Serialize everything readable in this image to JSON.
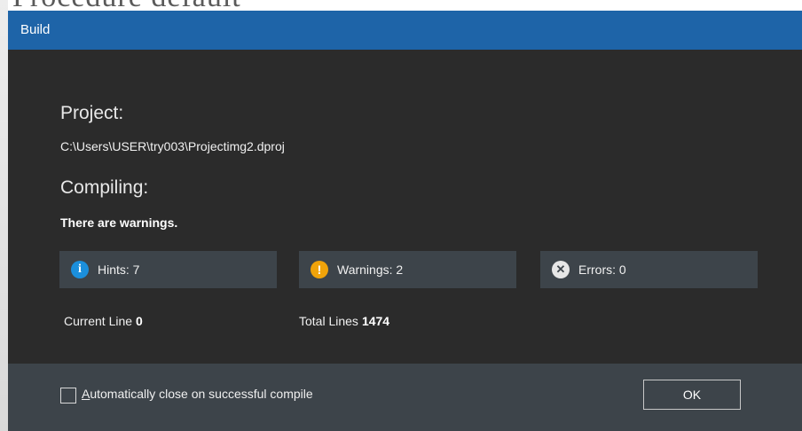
{
  "window": {
    "title": "Build"
  },
  "backdrop": {
    "text": "Procedure  default"
  },
  "project": {
    "heading": "Project:",
    "path": "C:\\Users\\USER\\try003\\Projectimg2.dproj"
  },
  "compiling": {
    "heading": "Compiling:",
    "status": "There are warnings."
  },
  "stats": {
    "hints_label": "Hints: 7",
    "warnings_label": "Warnings: 2",
    "errors_label": "Errors: 0"
  },
  "lines": {
    "current_label": "Current Line",
    "current_value": "0",
    "total_label": "Total Lines",
    "total_value": "1474"
  },
  "footer": {
    "auto_close_label": "Automatically close on successful compile",
    "auto_close_checked": false,
    "ok_label": "OK"
  },
  "icons": {
    "hint": "info-icon",
    "warning": "warning-icon",
    "error": "error-icon"
  },
  "colors": {
    "titlebar": "#1e64a8",
    "body": "#2b2b2b",
    "panel": "#3d444a",
    "hint": "#1b8fdc",
    "warning": "#f0a30a"
  }
}
